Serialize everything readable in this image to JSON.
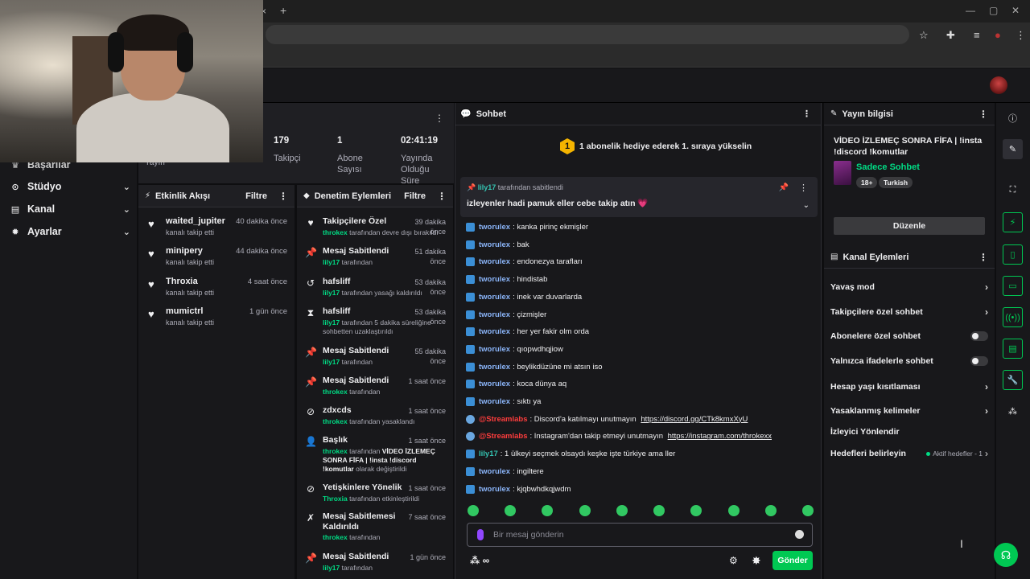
{
  "browser": {
    "tab_close": "×",
    "new_tab": "+"
  },
  "nav": {
    "items": [
      {
        "label": "Başarılar",
        "icon": "trophy-icon"
      },
      {
        "label": "Stüdyo",
        "icon": "studio-icon"
      },
      {
        "label": "Kanal",
        "icon": "channel-icon"
      },
      {
        "label": "Ayarlar",
        "icon": "gear-icon"
      }
    ],
    "partial_label": "Yayın"
  },
  "stats": [
    {
      "value": "179",
      "label": "Takipçi"
    },
    {
      "value": "1",
      "label": "Abone Sayısı"
    },
    {
      "value": "02:41:19",
      "label": "Yayında Olduğu Süre"
    }
  ],
  "activity": {
    "title": "Etkinlik Akışı",
    "filter": "Filtre",
    "items": [
      {
        "name": "waited_jupiter",
        "time": "40 dakika önce",
        "sub": "kanalı takip etti"
      },
      {
        "name": "minipery",
        "time": "44 dakika önce",
        "sub": "kanalı takip etti"
      },
      {
        "name": "Throxia",
        "time": "4 saat önce",
        "sub": "kanalı takip etti"
      },
      {
        "name": "mumictrl",
        "time": "1 gün önce",
        "sub": "kanalı takip etti"
      }
    ]
  },
  "mod": {
    "title": "Denetim Eylemleri",
    "filter": "Filtre",
    "items": [
      {
        "title": "Takipçilere Özel",
        "time": "39 dakika önce",
        "user": "throkex",
        "desc": " tarafından devre dışı bırakıldı"
      },
      {
        "title": "Mesaj Sabitlendi",
        "time": "51 dakika önce",
        "user": "lily17",
        "desc": " tarafından"
      },
      {
        "title": "hafsliff",
        "time": "53 dakika önce",
        "user": "lily17",
        "desc": " tarafından yasağı kaldırıldı"
      },
      {
        "title": "hafsliff",
        "time": "53 dakika önce",
        "user": "lily17",
        "desc": " tarafından 5 dakika süreliğine sohbetten uzaklaştırıldı"
      },
      {
        "title": "Mesaj Sabitlendi",
        "time": "55 dakika önce",
        "user": "lily17",
        "desc": " tarafından"
      },
      {
        "title": "Mesaj Sabitlendi",
        "time": "1 saat önce",
        "user": "throkex",
        "desc": " tarafından"
      },
      {
        "title": "zdxcds",
        "time": "1 saat önce",
        "user": "throkex",
        "desc": " tarafından yasaklandı"
      },
      {
        "title": "Başlık",
        "time": "1 saat önce",
        "user": "throkex",
        "desc": " tarafından ",
        "bold": "VİDEO İZLEMEÇ SONRA FİFA | !insta !discord !komutlar",
        "desc2": " olarak değiştirildi"
      },
      {
        "title": "Yetişkinlere Yönelik",
        "time": "1 saat önce",
        "user": "Throxia",
        "desc": " tarafından etkinleştirildi"
      },
      {
        "title": "Mesaj Sabitlemesi Kaldırıldı",
        "time": "7 saat önce",
        "user": "throkex",
        "desc": " tarafından"
      },
      {
        "title": "Mesaj Sabitlendi",
        "time": "1 gün önce",
        "user": "lily17",
        "desc": " tarafından"
      }
    ]
  },
  "chat": {
    "title": "Sohbet",
    "hype_level": "1",
    "hype_text": "1 abonelik hediye ederek 1. sıraya yükselin",
    "pinned_by_user": "lily17",
    "pinned_by_text": " tarafından sabitlendi",
    "pinned_message": "izleyenler hadi pamuk eller cebe takip atın 💗",
    "messages": [
      {
        "type": "tw",
        "user": "tworulex",
        "text": ": kanka pirinç ekmişler"
      },
      {
        "type": "tw",
        "user": "tworulex",
        "text": ": bak"
      },
      {
        "type": "tw",
        "user": "tworulex",
        "text": ": endonezya tarafları"
      },
      {
        "type": "tw",
        "user": "tworulex",
        "text": ": hindistab"
      },
      {
        "type": "tw",
        "user": "tworulex",
        "text": ": inek var duvarlarda"
      },
      {
        "type": "tw",
        "user": "tworulex",
        "text": ": çizmişler"
      },
      {
        "type": "tw",
        "user": "tworulex",
        "text": ": her yer fakir olm orda"
      },
      {
        "type": "tw",
        "user": "tworulex",
        "text": ": qıopwdhqjiow"
      },
      {
        "type": "tw",
        "user": "tworulex",
        "text": ": beylikdüzüne mi atsın iso"
      },
      {
        "type": "tw",
        "user": "tworulex",
        "text": ": koca dünya aq"
      },
      {
        "type": "tw",
        "user": "tworulex",
        "text": ": sıktı ya"
      },
      {
        "type": "sl",
        "user": "@Streamlabs",
        "text": ": Discord'a katılmayı unutmayın ",
        "link": "https://discord.gg/CTk8kmxXyU"
      },
      {
        "type": "sl",
        "user": "@Streamlabs",
        "text": ": Instagram'dan takip etmeyi unutmayın ",
        "link": "https://instagram.com/throkexx"
      },
      {
        "type": "li",
        "user": "lily17",
        "text": ": 1 ülkeyi seçmek olsaydı keşke işte türkiye ama ller"
      },
      {
        "type": "tw",
        "user": "tworulex",
        "text": ": ingiltere"
      },
      {
        "type": "tw",
        "user": "tworulex",
        "text": ": kjqbwhdkqjwdm"
      }
    ],
    "placeholder": "Bir mesaj gönderin",
    "send": "Gönder",
    "points": "∞"
  },
  "info": {
    "title": "Yayın bilgisi",
    "stream_title": "VİDEO İZLEMEÇ SONRA FİFA | !insta !discord !komutlar",
    "category": "Sadece Sohbet",
    "tags": [
      "18+",
      "Turkish"
    ],
    "edit": "Düzenle"
  },
  "channel_actions": {
    "title": "Kanal Eylemleri",
    "items": [
      {
        "label": "Yavaş mod",
        "kind": "chevron"
      },
      {
        "label": "Takipçilere özel sohbet",
        "kind": "chevron"
      },
      {
        "label": "Abonelere özel sohbet",
        "kind": "toggle"
      },
      {
        "label": "Yalnızca ifadelerle sohbet",
        "kind": "toggle"
      },
      {
        "label": "Hesap yaşı kısıtlaması",
        "kind": "chevron"
      },
      {
        "label": "Yasaklanmış kelimeler",
        "kind": "chevron"
      },
      {
        "label": "İzleyici Yönlendir",
        "kind": "none"
      },
      {
        "label": "Hedefleri belirleyin",
        "kind": "goal",
        "status": "Aktif hedefler - 1"
      }
    ]
  },
  "colors": {
    "accent": "#00c853",
    "brand_green": "#00db84",
    "bg": "#18181b",
    "streamlabs": "#ff3d3d"
  }
}
